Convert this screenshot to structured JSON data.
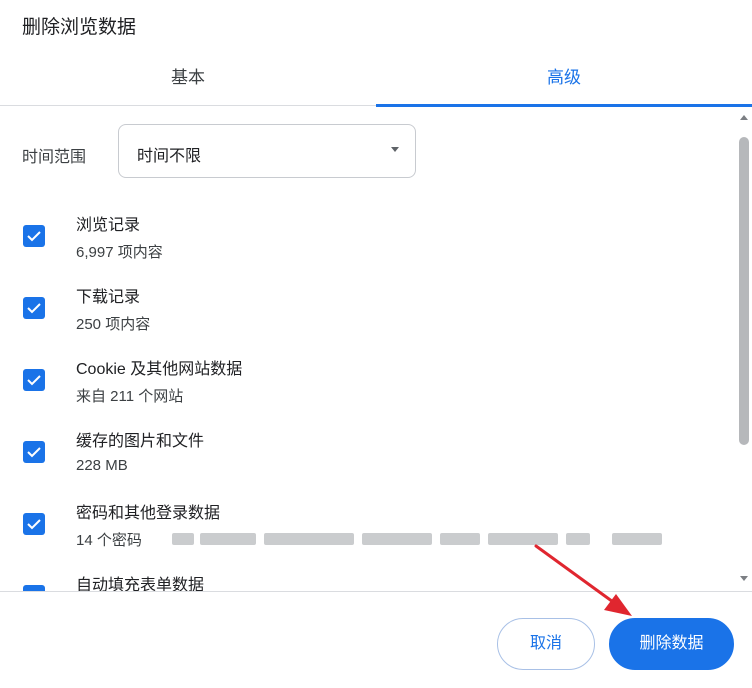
{
  "dialog": {
    "title": "删除浏览数据"
  },
  "tabs": [
    {
      "label": "基本",
      "active": false
    },
    {
      "label": "高级",
      "active": true
    }
  ],
  "time_range": {
    "label": "时间范围",
    "selected": "时间不限"
  },
  "items": [
    {
      "title": "浏览记录",
      "detail": "6,997 项内容",
      "checked": true
    },
    {
      "title": "下载记录",
      "detail": "250 项内容",
      "checked": true
    },
    {
      "title": "Cookie 及其他网站数据",
      "detail": "来自 211 个网站",
      "checked": true
    },
    {
      "title": "缓存的图片和文件",
      "detail": "228 MB",
      "checked": true
    },
    {
      "title": "密码和其他登录数据",
      "detail": "14 个密码",
      "checked": true
    },
    {
      "title": "自动填充表单数据",
      "detail": "",
      "checked": true
    }
  ],
  "footer": {
    "cancel_label": "取消",
    "delete_label": "删除数据"
  },
  "colors": {
    "accent": "#1a73e8",
    "annotation_arrow": "#e0262f"
  }
}
